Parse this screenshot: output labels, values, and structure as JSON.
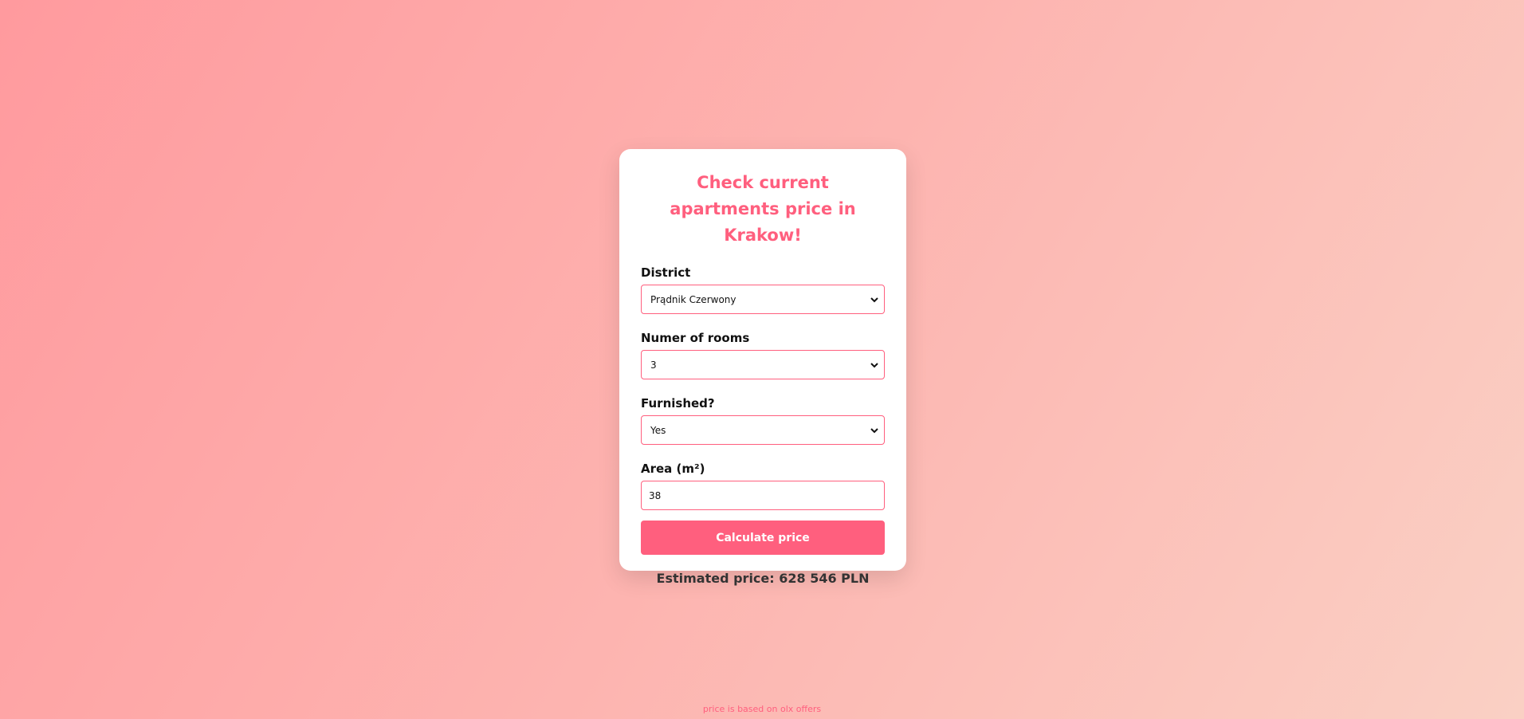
{
  "card": {
    "title": "Check current apartments price in Krakow!"
  },
  "form": {
    "district": {
      "label": "District",
      "value": "Prądnik Czerwony"
    },
    "rooms": {
      "label": "Numer of rooms",
      "value": "3"
    },
    "furnished": {
      "label": "Furnished?",
      "value": "Yes"
    },
    "area": {
      "label": "Area (m²)",
      "value": "38"
    },
    "submit_label": "Calculate price"
  },
  "result": {
    "text": "Estimated price: 628 546 PLN"
  },
  "footer": {
    "note": "price is based on olx offers"
  },
  "colors": {
    "accent": "#ff5f7e",
    "gradient_start": "#ff9a9e",
    "gradient_end": "#fad0c4"
  }
}
